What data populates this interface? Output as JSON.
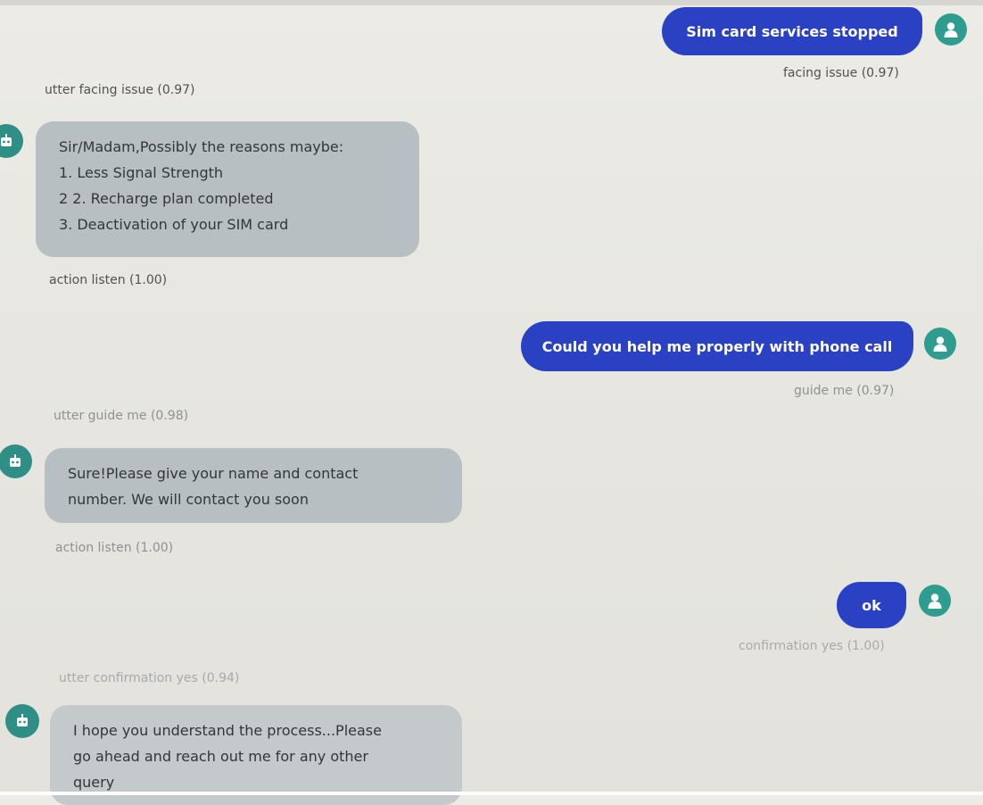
{
  "messages": [
    {
      "sender": "user",
      "text": "Sim card services stopped",
      "intent_label": "facing issue (0.97)"
    },
    {
      "sender": "bot",
      "action_label": "utter facing issue (0.97)",
      "lines": [
        "Sir/Madam,Possibly the reasons maybe:",
        "1. Less Signal Strength",
        "2 2. Recharge plan completed",
        "3. Deactivation of your SIM card"
      ],
      "next_action_label": "action listen (1.00)"
    },
    {
      "sender": "user",
      "text": "Could you help me properly with phone call",
      "intent_label": "guide me (0.97)"
    },
    {
      "sender": "bot",
      "action_label": "utter guide me (0.98)",
      "lines": [
        "Sure!Please give your name and contact",
        "number. We will contact you soon"
      ],
      "next_action_label": "action listen (1.00)"
    },
    {
      "sender": "user",
      "text": "ok",
      "intent_label": "confirmation yes (1.00)"
    },
    {
      "sender": "bot",
      "action_label": "utter confirmation yes (0.94)",
      "lines": [
        "I hope you understand the process...Please",
        "go ahead and reach out me for any other",
        "query"
      ]
    }
  ],
  "icons": {
    "user_avatar": "person-icon",
    "bot_avatar": "robot-icon"
  },
  "colors": {
    "user_bubble": "#2b41c4",
    "bot_bubble": "#b8bfc3",
    "avatar": "#2e9c8f",
    "background": "#e8e7e2"
  }
}
